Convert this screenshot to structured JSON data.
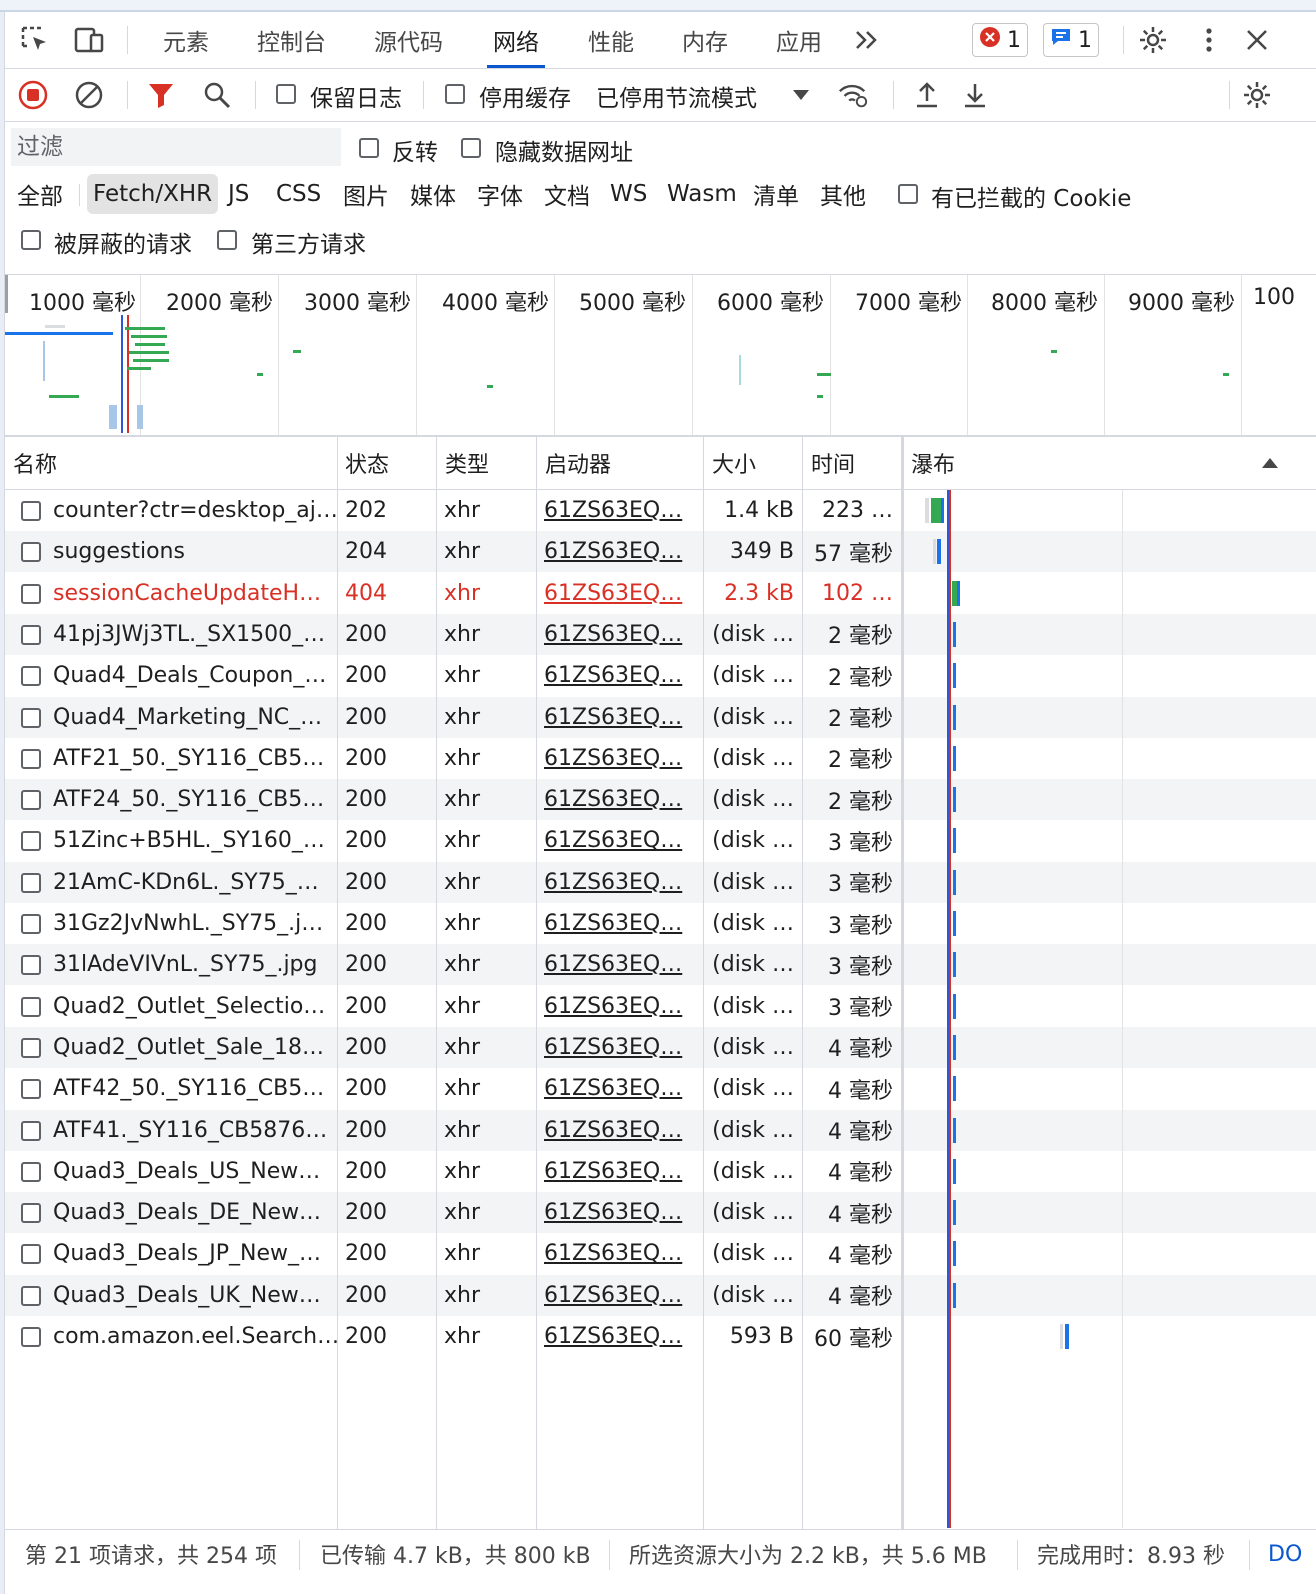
{
  "tabs": [
    "元素",
    "控制台",
    "源代码",
    "网络",
    "性能",
    "内存",
    "应用"
  ],
  "active_tab": "网络",
  "more_tabs_icon": "chevron-double-right-icon",
  "error_count": "1",
  "message_count": "1",
  "toolbar": {
    "preserve_log": "保留日志",
    "disable_cache": "停用缓存",
    "throttling": "已停用节流模式"
  },
  "filter": {
    "placeholder": "过滤",
    "invert": "反转",
    "hide_data_urls": "隐藏数据网址",
    "types": [
      "全部",
      "Fetch/XHR",
      "JS",
      "CSS",
      "图片",
      "媒体",
      "字体",
      "文档",
      "WS",
      "Wasm",
      "清单",
      "其他"
    ],
    "selected_type": "Fetch/XHR",
    "blocked_cookies": "有已拦截的 Cookie",
    "blocked_requests": "被屏蔽的请求",
    "third_party": "第三方请求"
  },
  "overview_ticks": [
    "1000 毫秒",
    "2000 毫秒",
    "3000 毫秒",
    "4000 毫秒",
    "5000 毫秒",
    "6000 毫秒",
    "7000 毫秒",
    "8000 毫秒",
    "9000 毫秒",
    "100"
  ],
  "columns": [
    "名称",
    "状态",
    "类型",
    "启动器",
    "大小",
    "时间",
    "瀑布"
  ],
  "rows": [
    {
      "name": "counter?ctr=desktop_aj…",
      "status": "202",
      "type": "xhr",
      "initiator": "61ZS63EQ…",
      "size": "1.4 kB",
      "time": "223 …"
    },
    {
      "name": "suggestions",
      "status": "204",
      "type": "xhr",
      "initiator": "61ZS63EQ…",
      "size": "349 B",
      "time": "57 毫秒"
    },
    {
      "name": "sessionCacheUpdateH…",
      "status": "404",
      "type": "xhr",
      "initiator": "61ZS63EQ…",
      "size": "2.3 kB",
      "time": "102 …",
      "error": true
    },
    {
      "name": "41pj3JWj3TL._SX1500_…",
      "status": "200",
      "type": "xhr",
      "initiator": "61ZS63EQ…",
      "size": "(disk …",
      "time": "2 毫秒"
    },
    {
      "name": "Quad4_Deals_Coupon_…",
      "status": "200",
      "type": "xhr",
      "initiator": "61ZS63EQ…",
      "size": "(disk …",
      "time": "2 毫秒"
    },
    {
      "name": "Quad4_Marketing_NC_…",
      "status": "200",
      "type": "xhr",
      "initiator": "61ZS63EQ…",
      "size": "(disk …",
      "time": "2 毫秒"
    },
    {
      "name": "ATF21_50._SY116_CB5…",
      "status": "200",
      "type": "xhr",
      "initiator": "61ZS63EQ…",
      "size": "(disk …",
      "time": "2 毫秒"
    },
    {
      "name": "ATF24_50._SY116_CB5…",
      "status": "200",
      "type": "xhr",
      "initiator": "61ZS63EQ…",
      "size": "(disk …",
      "time": "2 毫秒"
    },
    {
      "name": "51Zinc+B5HL._SY160_…",
      "status": "200",
      "type": "xhr",
      "initiator": "61ZS63EQ…",
      "size": "(disk …",
      "time": "3 毫秒"
    },
    {
      "name": "21AmC-KDn6L._SY75_…",
      "status": "200",
      "type": "xhr",
      "initiator": "61ZS63EQ…",
      "size": "(disk …",
      "time": "3 毫秒"
    },
    {
      "name": "31Gz2JvNwhL._SY75_.j…",
      "status": "200",
      "type": "xhr",
      "initiator": "61ZS63EQ…",
      "size": "(disk …",
      "time": "3 毫秒"
    },
    {
      "name": "31lAdeVIVnL._SY75_.jpg",
      "status": "200",
      "type": "xhr",
      "initiator": "61ZS63EQ…",
      "size": "(disk …",
      "time": "3 毫秒"
    },
    {
      "name": "Quad2_Outlet_Selectio…",
      "status": "200",
      "type": "xhr",
      "initiator": "61ZS63EQ…",
      "size": "(disk …",
      "time": "3 毫秒"
    },
    {
      "name": "Quad2_Outlet_Sale_18…",
      "status": "200",
      "type": "xhr",
      "initiator": "61ZS63EQ…",
      "size": "(disk …",
      "time": "4 毫秒"
    },
    {
      "name": "ATF42_50._SY116_CB5…",
      "status": "200",
      "type": "xhr",
      "initiator": "61ZS63EQ…",
      "size": "(disk …",
      "time": "4 毫秒"
    },
    {
      "name": "ATF41._SY116_CB5876…",
      "status": "200",
      "type": "xhr",
      "initiator": "61ZS63EQ…",
      "size": "(disk …",
      "time": "4 毫秒"
    },
    {
      "name": "Quad3_Deals_US_New…",
      "status": "200",
      "type": "xhr",
      "initiator": "61ZS63EQ…",
      "size": "(disk …",
      "time": "4 毫秒"
    },
    {
      "name": "Quad3_Deals_DE_New…",
      "status": "200",
      "type": "xhr",
      "initiator": "61ZS63EQ…",
      "size": "(disk …",
      "time": "4 毫秒"
    },
    {
      "name": "Quad3_Deals_JP_New_…",
      "status": "200",
      "type": "xhr",
      "initiator": "61ZS63EQ…",
      "size": "(disk …",
      "time": "4 毫秒"
    },
    {
      "name": "Quad3_Deals_UK_New…",
      "status": "200",
      "type": "xhr",
      "initiator": "61ZS63EQ…",
      "size": "(disk …",
      "time": "4 毫秒"
    },
    {
      "name": "com.amazon.eel.Search…",
      "status": "200",
      "type": "xhr",
      "initiator": "61ZS63EQ…",
      "size": "593 B",
      "time": "60 毫秒"
    }
  ],
  "status_bar": {
    "requests": "第 21 项请求，共 254 项",
    "transferred": "已传输 4.7 kB，共 800 kB",
    "resources": "所选资源大小为 2.2 kB，共 5.6 MB",
    "finish": "完成用时：8.93 秒",
    "truncated": "DO"
  },
  "colors": {
    "accent": "#0b57d0",
    "error": "#d93025",
    "bar_green": "#34a853",
    "bar_blue": "#1a73e8"
  }
}
